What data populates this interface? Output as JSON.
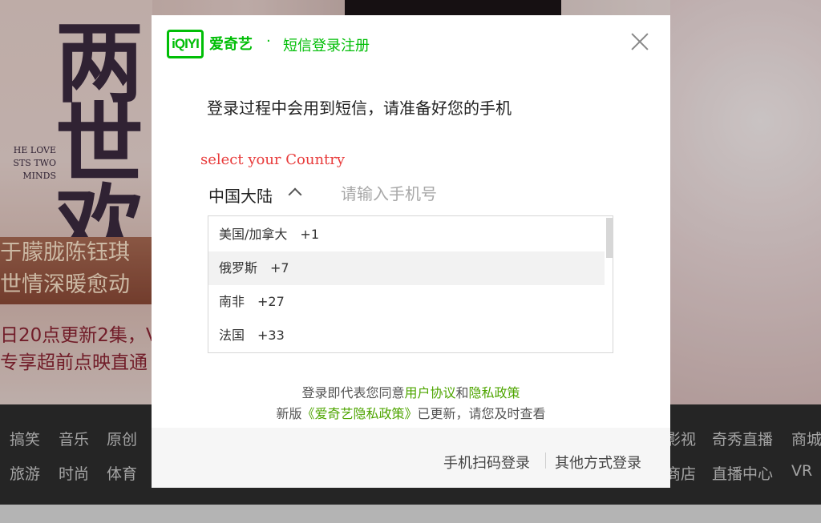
{
  "background": {
    "poster": {
      "title": "两世欢",
      "subtitle_lines": [
        "HE LOVE",
        "STS TWO",
        "MINDS"
      ],
      "strip_lines": [
        "于朦胧陈钰琪",
        "世情深暖愈动"
      ],
      "promo_lines": [
        "日20点更新2集，V",
        "专享超前点映直通"
      ]
    },
    "nav": {
      "left_row1": [
        "搞笑",
        "音乐",
        "原创"
      ],
      "left_row2": [
        "旅游",
        "时尚",
        "体育"
      ],
      "right_row1": [
        "影视",
        "奇秀直播",
        "商城"
      ],
      "right_row2": [
        "商店",
        "直播中心",
        "VR"
      ]
    }
  },
  "modal": {
    "logo_text": "iQIYI",
    "brand": "爱奇艺",
    "separator": "·",
    "title": "短信登录注册",
    "instruction": "登录过程中会用到短信，请准备好您的手机",
    "country_hint": "select your Country",
    "country_selected": "中国大陆",
    "phone_placeholder": "请输入手机号",
    "countries": [
      {
        "name": "美国/加拿大",
        "code": "+1"
      },
      {
        "name": "俄罗斯",
        "code": "+7"
      },
      {
        "name": "南非",
        "code": "+27"
      },
      {
        "name": "法国",
        "code": "+33"
      }
    ],
    "agreement": {
      "prefix": "登录即代表您同意",
      "user_agreement": "用户协议",
      "and": "和",
      "privacy_policy": "隐私政策",
      "line2_prefix": "新版",
      "new_policy": "《爱奇艺隐私政策》",
      "line2_suffix": "已更新，请您及时查看"
    },
    "footer": {
      "qr_login": "手机扫码登录",
      "other_login": "其他方式登录"
    }
  },
  "colors": {
    "brand_green": "#00be06",
    "link_green": "#4ea500",
    "hint_red": "#e83b3b"
  }
}
